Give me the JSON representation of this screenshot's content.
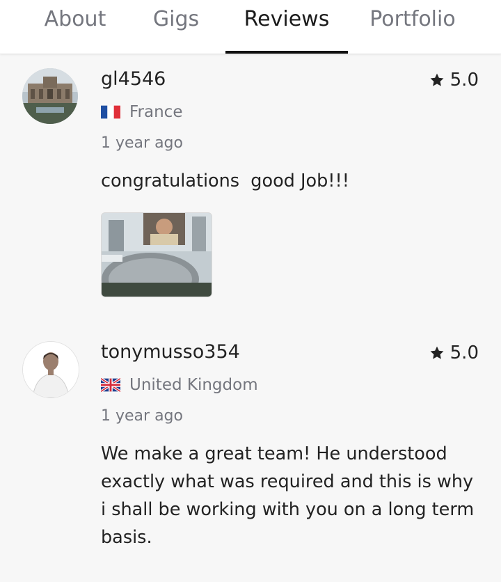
{
  "tabs": [
    {
      "label": "About",
      "active": false
    },
    {
      "label": "Gigs",
      "active": false
    },
    {
      "label": "Reviews",
      "active": true
    },
    {
      "label": "Portfolio",
      "active": false
    }
  ],
  "reviews": [
    {
      "username": "gl4546",
      "rating": "5.0",
      "country": "France",
      "flag": "france-flag",
      "time": "1 year ago",
      "comment": "congratulations  good Job!!!",
      "has_attachment": true
    },
    {
      "username": "tonymusso354",
      "rating": "5.0",
      "country": "United Kingdom",
      "flag": "uk-flag",
      "time": "1 year ago",
      "comment": "We make a great team! He understood exactly what was required and this is why i shall be working with you on a long term basis.",
      "has_attachment": false
    }
  ],
  "colors": {
    "active_tab": "#1b1b1b",
    "inactive_tab": "#74767e",
    "underline": "#111111",
    "muted_text": "#74767e",
    "page_background": "#f7f7f7"
  }
}
